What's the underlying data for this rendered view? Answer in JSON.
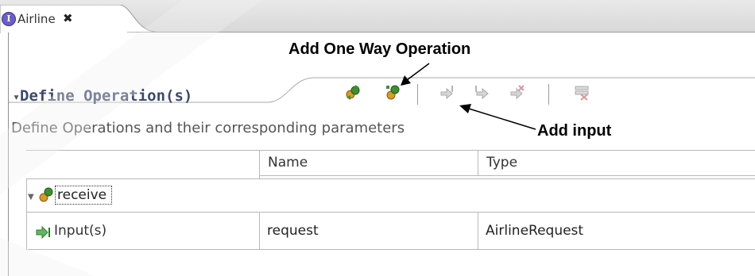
{
  "tab": {
    "title": "Airline",
    "close_glyph": "✖",
    "icon": "interface-icon"
  },
  "callouts": {
    "one_way": "Add One Way Operation",
    "add_input": "Add input"
  },
  "section": {
    "title": "Define Operation(s)",
    "collapse_glyph": "▾",
    "description": "Define Operations and their  corresponding parameters"
  },
  "toolbar": {
    "icons": [
      "add-request-response-operation-icon",
      "add-one-way-operation-icon",
      "add-input-icon",
      "add-output-icon",
      "add-fault-icon",
      "remove-icon"
    ]
  },
  "table": {
    "headers": [
      "Name",
      "Type"
    ],
    "operation": {
      "name": "receive"
    },
    "input_row": {
      "label": "Input(s)",
      "name": "request",
      "type": "AirlineRequest"
    }
  },
  "colors": {
    "section_title": "#3c4a6a",
    "tab_icon": "#6b5fc7",
    "gear_green": "#3f8f2f",
    "gear_orange": "#d99a22"
  }
}
